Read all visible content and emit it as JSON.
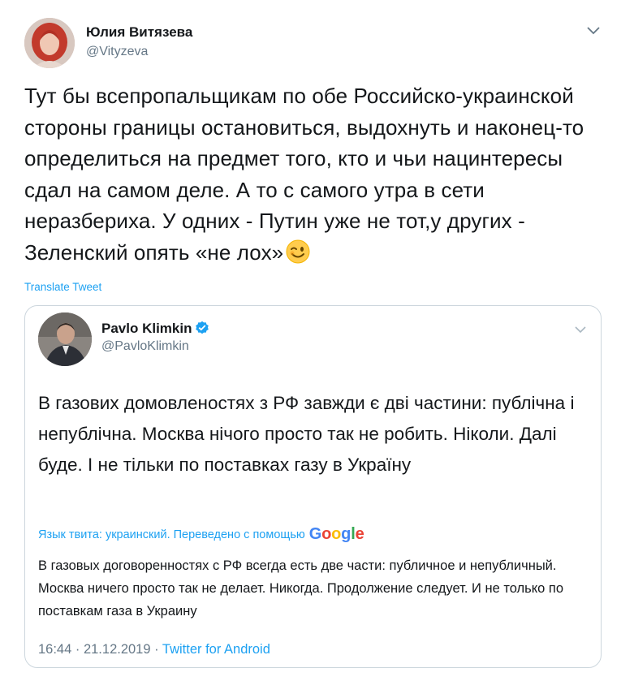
{
  "author": {
    "name": "Юлия Витязева",
    "handle": "@Vityzeva"
  },
  "tweet": {
    "text": "Тут бы всепропальщикам по обе Российско-украинской стороны границы остановиться, выдохнуть и наконец-то определиться на предмет того, кто и чьи нацинтересы сдал на самом деле. А то с самого утра в сети неразбериха. У одних - Путин уже не тот,у других - Зеленский опять «не лох»",
    "emoji": "winking-face"
  },
  "translate_label": "Translate Tweet",
  "quoted": {
    "name": "Pavlo Klimkin",
    "handle": "@PavloKlimkin",
    "verified": true,
    "text": "В газових домовленостях з РФ завжди є дві частини: публічна і непублічна. Москва нічого просто так не робить. Ніколи. Далі буде. І не тільки по поставках газу в Україну",
    "translation_note": "Язык твита: украинский. Переведено с помощью",
    "translator": "Google",
    "translation": "В газовых договоренностях с РФ всегда есть две части: публичное и непубличный. Москва ничего просто так не делает. Никогда. Продолжение следует. И не только по поставкам газа в Украину",
    "time": "16:44 · 21.12.2019 ·",
    "source": "Twitter for Android"
  },
  "colors": {
    "link": "#1da1f2",
    "secondary": "#657786",
    "border": "#ccd6dd"
  }
}
